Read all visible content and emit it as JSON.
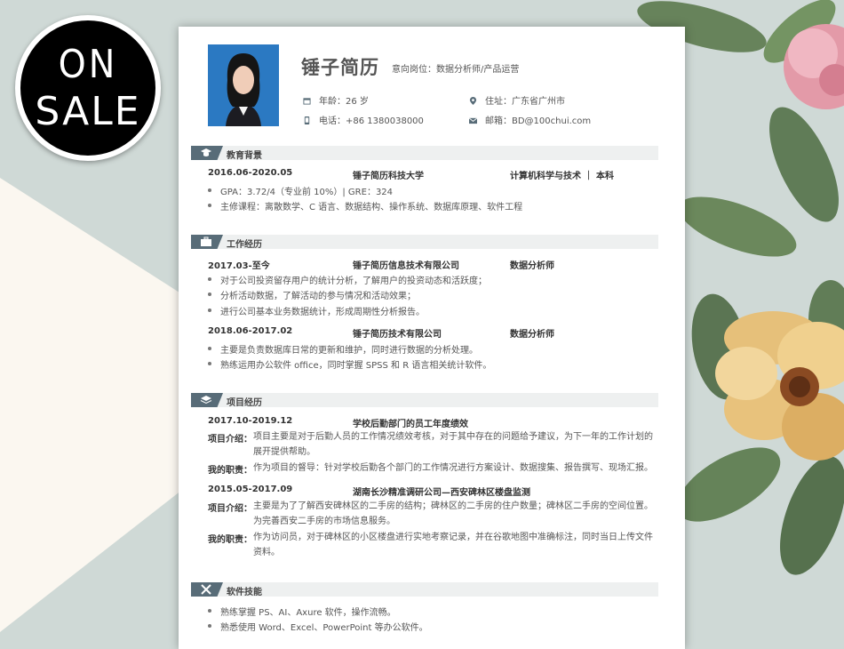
{
  "badge": {
    "line1": "ON",
    "line2": "SALE"
  },
  "resume": {
    "name": "锤子简历",
    "intent": "意向岗位：数据分析师/产品运营",
    "age": "年龄：26 岁",
    "address": "住址：广东省广州市",
    "phone": "电话：+86 1380038000",
    "email": "邮箱：BD@100chui.com"
  },
  "education": {
    "title": "教育背景",
    "date": "2016.06-2020.05",
    "school": "锤子简历科技大学",
    "major": "计算机科学与技术 ｜ 本科",
    "bullets": [
      "GPA：3.72/4（专业前 10%）| GRE：324",
      "主修课程：离散数学、C 语言、数据结构、操作系统、数据库原理、软件工程"
    ]
  },
  "work": {
    "title": "工作经历",
    "jobs": [
      {
        "date": "2017.03-至今",
        "company": "锤子简历信息技术有限公司",
        "role": "数据分析师",
        "bullets": [
          "对于公司投资留存用户的统计分析，了解用户的投资动态和活跃度；",
          "分析活动数据，了解活动的参与情况和活动效果；",
          "进行公司基本业务数据统计，形成周期性分析报告。"
        ]
      },
      {
        "date": "2018.06-2017.02",
        "company": "锤子简历技术有限公司",
        "role": "数据分析师",
        "bullets": [
          "主要是负责数据库日常的更新和维护，同时进行数据的分析处理。",
          "熟练运用办公软件 office，同时掌握 SPSS 和 R 语言相关统计软件。"
        ]
      }
    ]
  },
  "projects": {
    "title": "项目经历",
    "intro_label": "项目介绍：",
    "duty_label": "我的职责：",
    "items": [
      {
        "date": "2017.10-2019.12",
        "name": "学校后勤部门的员工年度绩效",
        "intro1": "项目主要是对于后勤人员的工作情况绩效考核，对于其中存在的问题给予建议，为下一年的工作计划的",
        "intro2": "展开提供帮助。",
        "duty1": "作为项目的督导：针对学校后勤各个部门的工作情况进行方案设计、数据搜集、报告撰写、现场汇报。"
      },
      {
        "date": "2015.05-2017.09",
        "name": "湖南长沙精准调研公司—西安碑林区楼盘监测",
        "intro1": "主要是为了了解西安碑林区的二手房的结构；碑林区的二手房的住户数量；碑林区二手房的空间位置。",
        "intro2": "为完善西安二手房的市场信息服务。",
        "duty1": "作为访问员，对于碑林区的小区楼盘进行实地考察记录，并在谷歌地图中准确标注，同时当日上传文件",
        "duty2": "资料。"
      }
    ]
  },
  "skills": {
    "title": "软件技能",
    "bullets": [
      "熟练掌握 PS、AI、Axure 软件，操作流畅。",
      "熟悉使用 Word、Excel、PowerPoint 等办公软件。"
    ]
  },
  "colors": {
    "accent": "#586c78",
    "section_bg": "#eef0f0",
    "background": "#cfd9d6",
    "cream": "#fbf7f0"
  }
}
